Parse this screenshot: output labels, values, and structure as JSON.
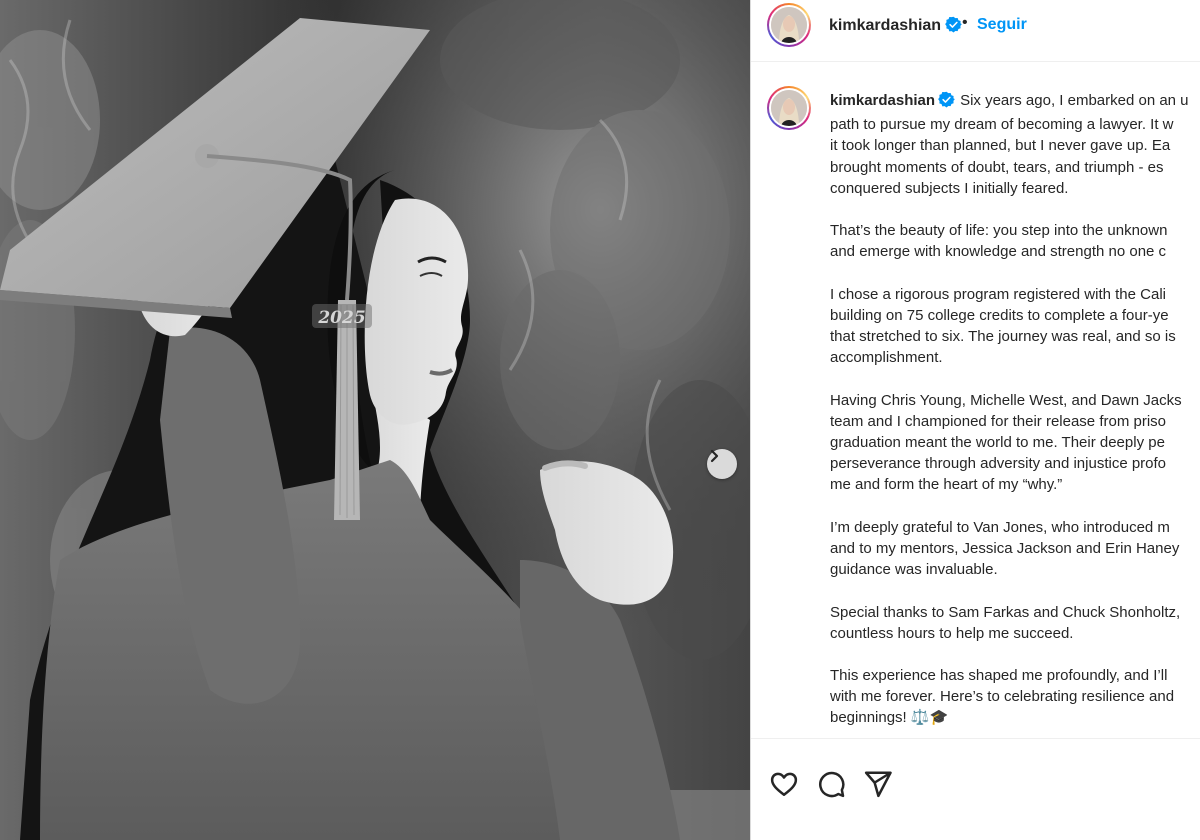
{
  "post": {
    "username": "kimkardashian",
    "verified": true,
    "separator": "•",
    "follow_label": "Seguir"
  },
  "caption": {
    "username": "kimkardashian",
    "lines": [
      "Six years ago, I embarked on an u",
      "path to pursue my dream of becoming a lawyer. It w",
      "it took longer than planned, but I never gave up. Ea",
      "brought moments of doubt, tears, and triumph - es",
      "conquered subjects I initially feared.",
      "",
      "That’s the beauty of life: you step into the unknown",
      "and emerge with knowledge and strength no one c",
      "",
      "I chose a rigorous program registered with the Cali",
      "building on 75 college credits to complete a four-ye",
      "that stretched to six. The journey was real, and so is",
      "accomplishment.",
      "",
      "Having Chris Young, Michelle West, and Dawn Jacks",
      "team and I championed for their release from priso",
      "graduation meant the world to me. Their deeply pe",
      "perseverance through adversity and injustice profo",
      "me and form the heart of my “why.”",
      "",
      "I’m deeply grateful to Van Jones, who introduced m",
      "and to my mentors, Jessica Jackson and Erin Haney",
      "guidance was invaluable.",
      "",
      "Special thanks to Sam Farkas and Chuck Shonholtz,",
      "countless hours to help me succeed.",
      "",
      "This experience has shaped me profoundly, and I’ll",
      "with me forever. Here’s to celebrating resilience and",
      "beginnings! ⚖️🎓"
    ]
  },
  "photo": {
    "cap_tassel_charm_text": "2025"
  },
  "icons": {
    "like": "heart-icon",
    "comment": "comment-icon",
    "share": "share-icon",
    "next": "chevron-right-icon",
    "verified": "verified-badge-icon"
  },
  "colors": {
    "follow_blue": "#0095f6",
    "verified_blue": "#0095f6",
    "text": "#262626",
    "divider": "#efefef"
  }
}
